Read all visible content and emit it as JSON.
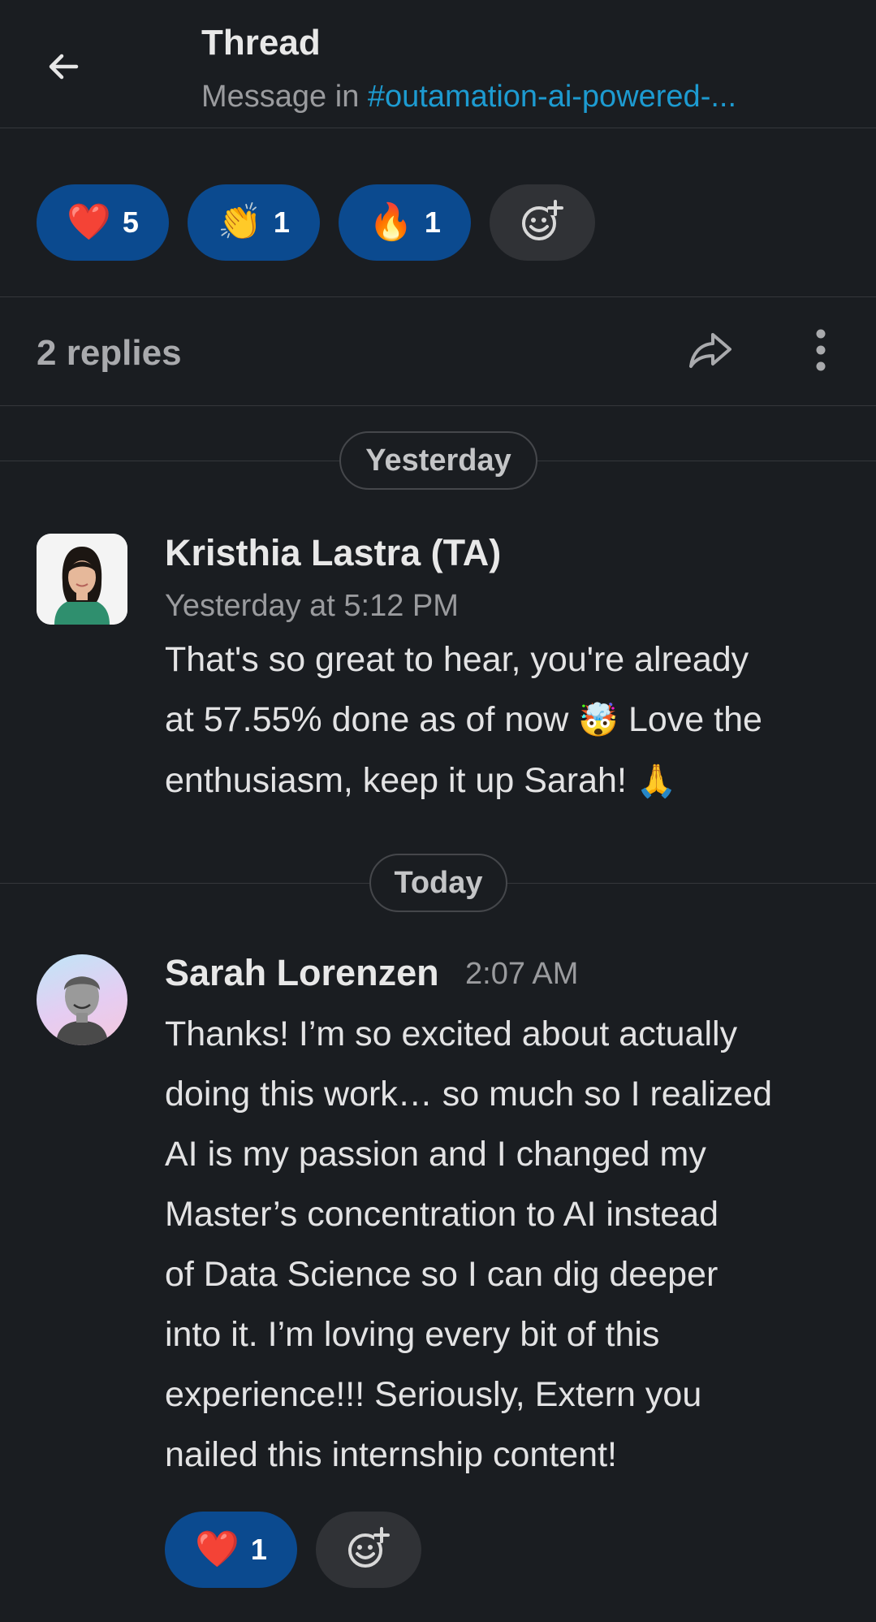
{
  "header": {
    "title": "Thread",
    "subtitle_prefix": "Message in ",
    "channel": "#outamation-ai-powered-..."
  },
  "reactions": [
    {
      "emoji": "❤️",
      "count": "5",
      "name": "heart"
    },
    {
      "emoji": "👏",
      "count": "1",
      "name": "clap"
    },
    {
      "emoji": "🔥",
      "count": "1",
      "name": "fire"
    }
  ],
  "replies": {
    "count_label": "2 replies"
  },
  "dividers": {
    "yesterday": "Yesterday",
    "today": "Today"
  },
  "messages": [
    {
      "author": "Kristhia Lastra (TA)",
      "time": "Yesterday at 5:12 PM",
      "line1": "That's so great to hear, you're already",
      "line2a": "at 57.55% done as of now ",
      "emoji_a": "🤯",
      "line2b": " Love the",
      "line3": "enthusiasm, keep it up Sarah! ",
      "emoji_b": "🙏"
    },
    {
      "author": "Sarah Lorenzen",
      "time": "2:07 AM",
      "lines": [
        "Thanks! I’m so excited about actually",
        "doing this work… so much so I realized",
        "AI is my passion and I changed my",
        "Master’s concentration to AI instead",
        "of Data Science so I can dig deeper",
        "into it. I’m loving every bit of this",
        "experience!!! Seriously, Extern you",
        "nailed this internship content!"
      ],
      "reaction": {
        "emoji": "❤️",
        "count": "1"
      }
    }
  ],
  "colors": {
    "background": "#1a1d21",
    "reaction_pill": "#0b4a8f",
    "link": "#1d9bd1"
  }
}
